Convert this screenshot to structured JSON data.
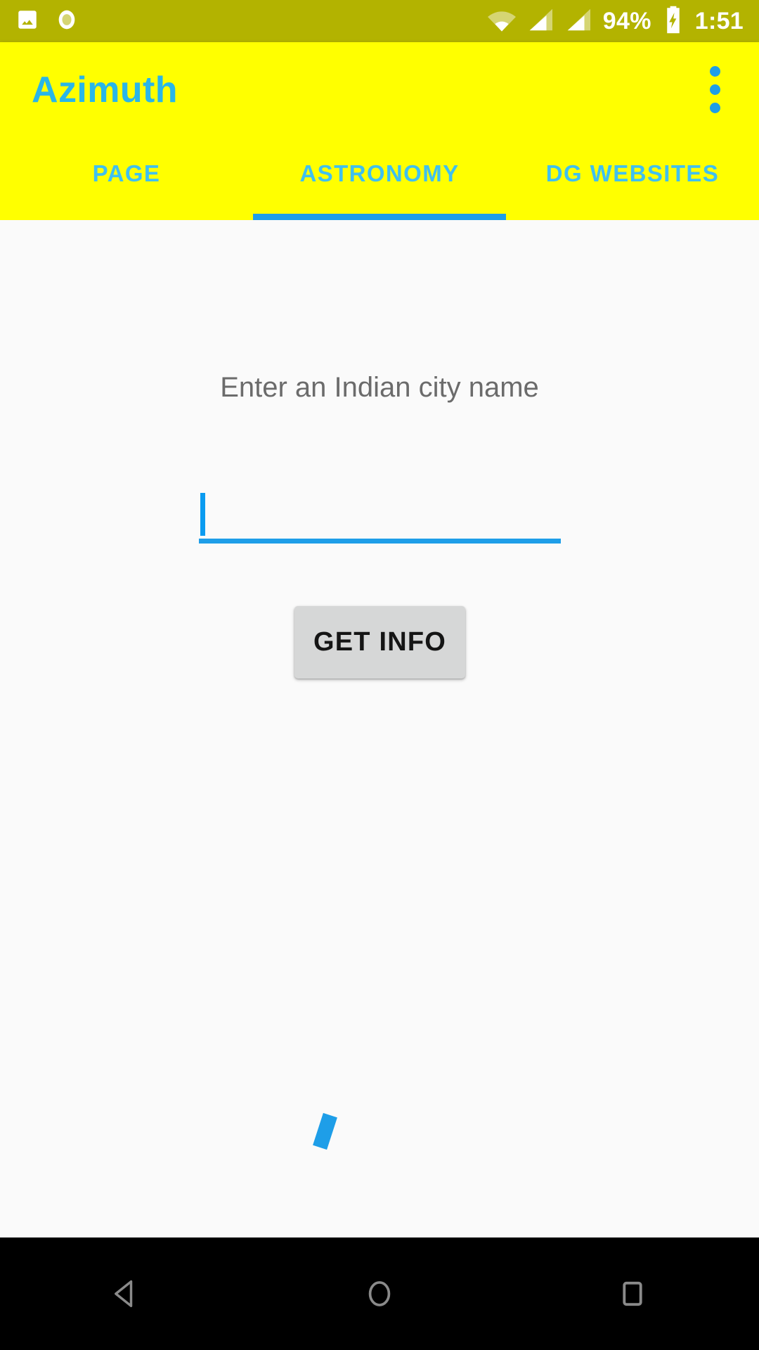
{
  "status_bar": {
    "background_color": "#b3b300",
    "text_color": "#ffffff",
    "left_icons": [
      {
        "name": "image-icon"
      },
      {
        "name": "screen-record-icon"
      }
    ],
    "right_icons": [
      {
        "name": "wifi-icon"
      },
      {
        "name": "signal-icon-1"
      },
      {
        "name": "signal-icon-2"
      }
    ],
    "battery_percent": "94%",
    "battery_state": "charging",
    "time": "1:51"
  },
  "app_bar": {
    "background_color": "#ffff00",
    "title": "Azimuth",
    "title_color": "#29b6e8",
    "overflow_menu_label": "More options"
  },
  "tabs": {
    "items": [
      {
        "label": "PAGE",
        "selected": false
      },
      {
        "label": "ASTRONOMY",
        "selected": true
      },
      {
        "label": "DG WEBSITES",
        "selected": false
      }
    ],
    "indicator_color": "#1e9ee8",
    "text_color": "#3fc0ef",
    "selected_index": 1
  },
  "content": {
    "background_color": "#fafafa",
    "field_label": "Enter an Indian city name",
    "city_input": {
      "value": "",
      "placeholder": "",
      "underline_color": "#1e9ee8",
      "focused": true
    },
    "get_info_button": {
      "label": "GET INFO",
      "background_color": "#d6d7d7",
      "text_color": "#151515"
    },
    "progress_indicator": {
      "name": "loading-spinner",
      "color": "#1e9ee8"
    }
  },
  "navigation_bar": {
    "background_color": "#000000",
    "buttons": [
      {
        "name": "back",
        "label": "Back"
      },
      {
        "name": "home",
        "label": "Home"
      },
      {
        "name": "recents",
        "label": "Recent apps"
      }
    ]
  }
}
